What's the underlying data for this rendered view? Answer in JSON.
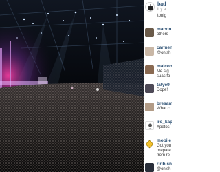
{
  "post": {
    "owner": "bad",
    "time": "il y a",
    "caption": "tonig"
  },
  "comments": [
    {
      "user": "marvin",
      "line1": "others",
      "line2": ""
    },
    {
      "user": "carmen",
      "line1": "@onish",
      "line2": ""
    },
    {
      "user": "maicon",
      "line1": "Me sig",
      "line2": "suas fo"
    },
    {
      "user": "tatye9",
      "line1": "Dope!",
      "line2": ""
    },
    {
      "user": "bresam",
      "line1": "What cl",
      "line2": ""
    },
    {
      "user": "iro_kap",
      "line1": "Xpetos",
      "line2": ""
    },
    {
      "user": "mobile",
      "line1": "Got you",
      "line2": "prepare"
    },
    {
      "user": "",
      "line1": "from re",
      "line2": ""
    },
    {
      "user": "ririhisn",
      "line1": "@onish",
      "line2": ""
    }
  ],
  "colors": {
    "username": "#2b4f72",
    "stage_glow": "#ff3fa8",
    "lights": "#cfe6ff"
  }
}
